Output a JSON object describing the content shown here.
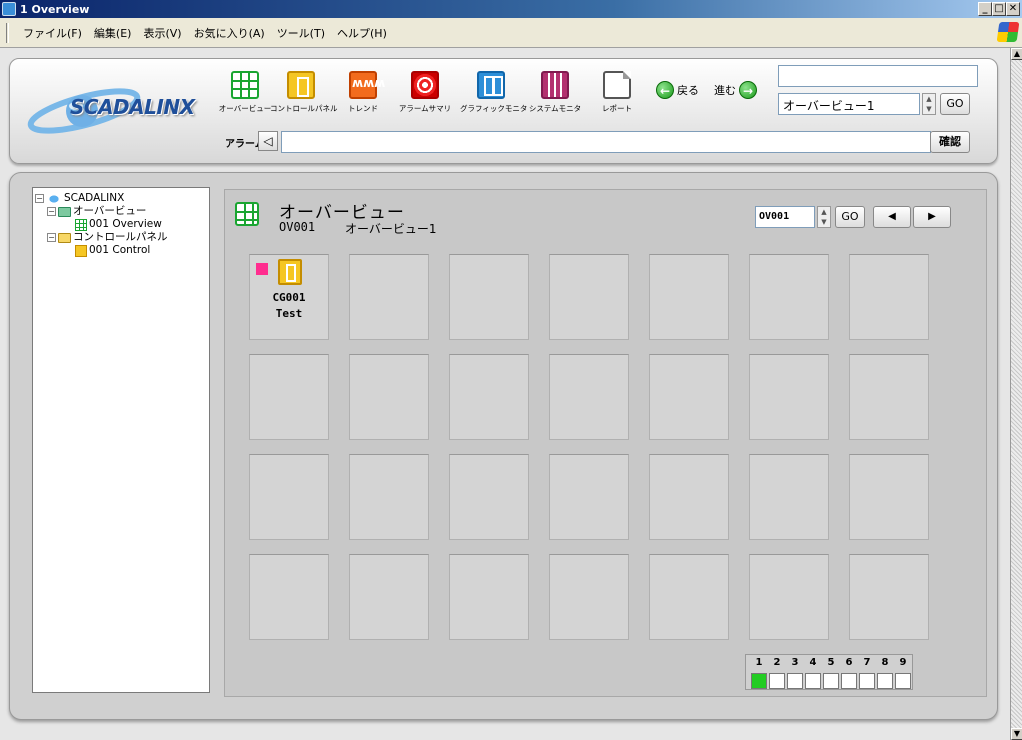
{
  "window": {
    "title": "1 Overview",
    "min": "_",
    "max": "□",
    "close": "✕"
  },
  "menu": [
    "ファイル(F)",
    "編集(E)",
    "表示(V)",
    "お気に入り(A)",
    "ツール(T)",
    "ヘルプ(H)"
  ],
  "logo": "SCADALINX",
  "toolbar": {
    "tools": [
      {
        "label": "オーバービュー",
        "icon": "overview-grid-icon"
      },
      {
        "label": "コントロールパネル",
        "icon": "control-panel-icon"
      },
      {
        "label": "トレンド",
        "icon": "trend-icon"
      },
      {
        "label": "アラームサマリ",
        "icon": "alarm-summary-icon"
      },
      {
        "label": "グラフィックモニタ",
        "icon": "graphic-monitor-icon"
      },
      {
        "label": "システムモニタ",
        "icon": "system-monitor-icon"
      },
      {
        "label": "レポート",
        "icon": "report-icon"
      }
    ],
    "back": "戻る",
    "forward": "進む",
    "page_select": "オーバービュー1",
    "go": "GO",
    "alarm_label": "アラーム",
    "confirm": "確認"
  },
  "tree": {
    "root": "SCADALINX",
    "group1": "オーバービュー",
    "item1": "001 Overview",
    "group2": "コントロールパネル",
    "item2": "001 Control"
  },
  "content": {
    "title": "オーバービュー",
    "code": "OV001",
    "name": "オーバービュー1",
    "code_field": "OV001",
    "go": "GO",
    "prev": "◀",
    "next": "▶",
    "tile1": {
      "code": "CG001",
      "name": "Test",
      "status_color": "#ff2d8f"
    },
    "pages": [
      "1",
      "2",
      "3",
      "4",
      "5",
      "6",
      "7",
      "8",
      "9"
    ],
    "active_page": "1"
  }
}
